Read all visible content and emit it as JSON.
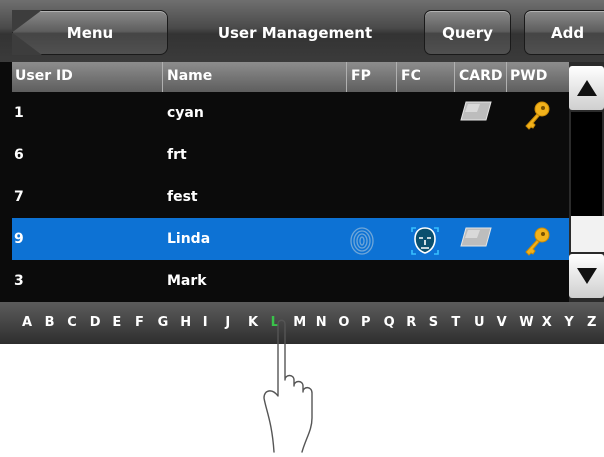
{
  "header": {
    "menu_label": "Menu",
    "title": "User Management",
    "query_label": "Query",
    "add_label": "Add"
  },
  "table": {
    "columns": [
      "User ID",
      "Name",
      "FP",
      "FC",
      "CARD",
      "PWD"
    ],
    "rows": [
      {
        "id": "1",
        "name": "cyan",
        "fp": false,
        "fc": false,
        "card": true,
        "pwd": true,
        "selected": false
      },
      {
        "id": "6",
        "name": "frt",
        "fp": false,
        "fc": false,
        "card": false,
        "pwd": false,
        "selected": false
      },
      {
        "id": "7",
        "name": "fest",
        "fp": false,
        "fc": false,
        "card": false,
        "pwd": false,
        "selected": false
      },
      {
        "id": "9",
        "name": "Linda",
        "fp": true,
        "fc": true,
        "card": true,
        "pwd": true,
        "selected": true
      },
      {
        "id": "3",
        "name": "Mark",
        "fp": false,
        "fc": false,
        "card": false,
        "pwd": false,
        "selected": false
      }
    ]
  },
  "alphabet": {
    "letters": [
      "A",
      "B",
      "C",
      "D",
      "E",
      "F",
      "G",
      "H",
      "I",
      "J",
      "K",
      "L",
      "M",
      "N",
      "O",
      "P",
      "Q",
      "R",
      "S",
      "T",
      "U",
      "V",
      "W",
      "X",
      "Y",
      "Z"
    ],
    "pressed": "L"
  },
  "colors": {
    "selected_row": "#0d72d4",
    "pressed_letter": "#39c24a",
    "key_icon": "#f2b21b"
  },
  "icons": {
    "fp": "fingerprint-icon",
    "fc": "face-icon",
    "card": "card-icon",
    "pwd": "key-icon",
    "scroll_up": "arrow-up-icon",
    "scroll_down": "arrow-down-icon"
  }
}
